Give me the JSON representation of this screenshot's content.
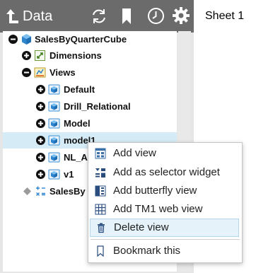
{
  "header": {
    "title": "Data",
    "icons": [
      "back-arrow-icon",
      "refresh-icon",
      "bookmark-icon",
      "clock-icon",
      "gear-icon"
    ]
  },
  "sheet_tab": "Sheet 1",
  "tree": {
    "root": {
      "label": "SalesByQuarterCube",
      "toggle": "collapse",
      "icon": "cube-icon"
    },
    "dimensions": {
      "label": "Dimensions",
      "toggle": "expand",
      "icon": "dimensions-icon"
    },
    "views": {
      "label": "Views",
      "toggle": "collapse",
      "icon": "views-icon"
    },
    "view_items": [
      "Default",
      "Drill_Relational",
      "Model",
      "model1",
      "NL_A",
      "v1"
    ],
    "selected_view": "model1",
    "last": {
      "label": "SalesBy",
      "icon": "calculation-icon"
    }
  },
  "context_menu": {
    "items": [
      {
        "label": "Add view",
        "icon": "add-view-icon"
      },
      {
        "label": "Add as selector widget",
        "icon": "selector-widget-icon"
      },
      {
        "label": "Add butterfly view",
        "icon": "butterfly-view-icon"
      },
      {
        "label": "Add TM1 web view",
        "icon": "tm1-web-view-icon"
      },
      {
        "label": "Delete view",
        "icon": "trash-icon"
      },
      {
        "label": "Bookmark this",
        "icon": "bookmark-icon"
      }
    ],
    "highlighted": "Delete view"
  },
  "colors": {
    "header": "#6b6b6b",
    "selection": "#d5ebf5",
    "menu_highlight": "#e5f2fa",
    "cube_blue": "#3b8fd6"
  }
}
